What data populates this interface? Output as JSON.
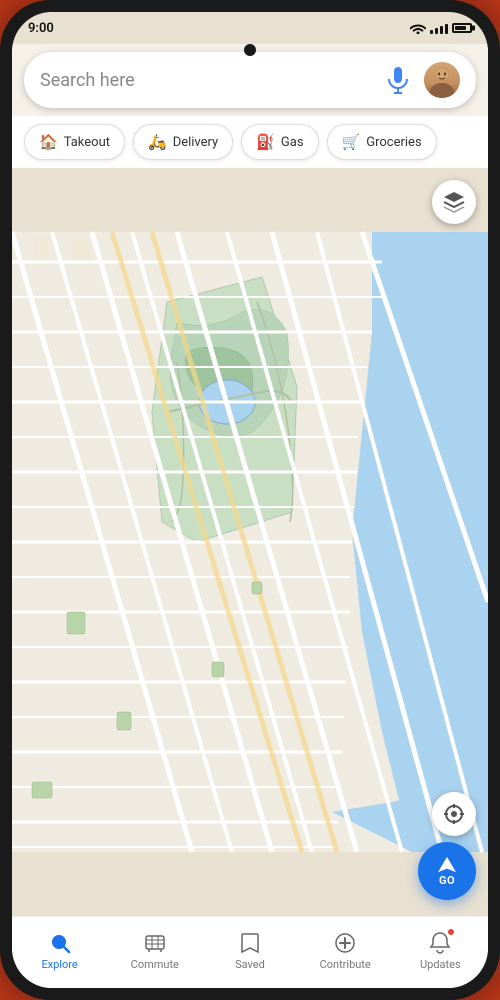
{
  "status": {
    "time": "9:00",
    "signal_label": "signal",
    "wifi_label": "wifi",
    "battery_label": "battery"
  },
  "search": {
    "placeholder": "Search here",
    "mic_icon": "microphone-icon",
    "avatar_icon": "user-avatar"
  },
  "filters": [
    {
      "id": "takeout",
      "label": "Takeout",
      "icon": "🏠"
    },
    {
      "id": "delivery",
      "label": "Delivery",
      "icon": "🛵"
    },
    {
      "id": "gas",
      "label": "Gas",
      "icon": "⛽"
    },
    {
      "id": "groceries",
      "label": "Groceries",
      "icon": "🛒"
    }
  ],
  "map": {
    "layer_button_label": "Map layers",
    "location_button_label": "My location",
    "go_button_label": "GO"
  },
  "nav": {
    "items": [
      {
        "id": "explore",
        "label": "Explore",
        "active": true
      },
      {
        "id": "commute",
        "label": "Commute",
        "active": false
      },
      {
        "id": "saved",
        "label": "Saved",
        "active": false
      },
      {
        "id": "contribute",
        "label": "Contribute",
        "active": false
      },
      {
        "id": "updates",
        "label": "Updates",
        "active": false,
        "has_notification": true
      }
    ]
  }
}
